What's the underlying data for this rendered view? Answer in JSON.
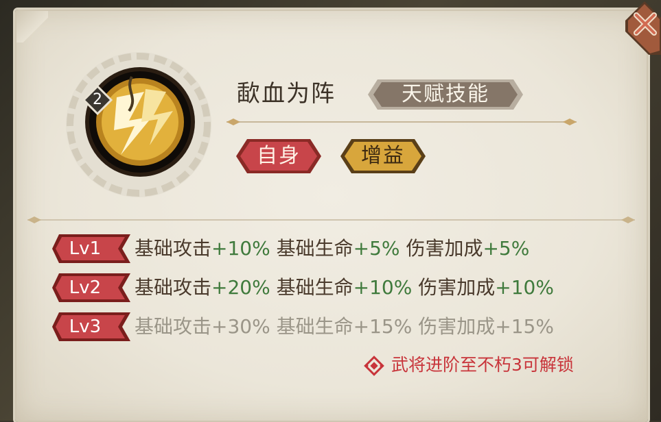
{
  "skill": {
    "name": "歃血为阵",
    "type_label": "天赋技能",
    "level_badge": "2",
    "icon": "lightning-dragon-emblem-icon",
    "tags": [
      {
        "label": "自身",
        "color": "#c8454a"
      },
      {
        "label": "增益",
        "color": "#d8a63c"
      }
    ]
  },
  "levels": [
    {
      "badge": "Lv1",
      "state": "unlocked",
      "effects": [
        {
          "stat": "基础攻击",
          "value": "+10%"
        },
        {
          "stat": "基础生命",
          "value": "+5%"
        },
        {
          "stat": "伤害加成",
          "value": "+5%"
        }
      ]
    },
    {
      "badge": "Lv2",
      "state": "unlocked",
      "effects": [
        {
          "stat": "基础攻击",
          "value": "+20%"
        },
        {
          "stat": "基础生命",
          "value": "+10%"
        },
        {
          "stat": "伤害加成",
          "value": "+10%"
        }
      ]
    },
    {
      "badge": "Lv3",
      "state": "locked",
      "effects": [
        {
          "stat": "基础攻击",
          "value": "+30%"
        },
        {
          "stat": "基础生命",
          "value": "+15%"
        },
        {
          "stat": "伤害加成",
          "value": "+15%"
        }
      ]
    }
  ],
  "unlock_hint": "武将进阶至不朽3可解锁",
  "unlock_icon": "knot-icon",
  "close_icon": "close-icon",
  "colors": {
    "text_dark": "#4a3a2c",
    "value_green": "#3f7a3c",
    "locked_grey": "#9a9588",
    "accent_red": "#c8343a"
  }
}
